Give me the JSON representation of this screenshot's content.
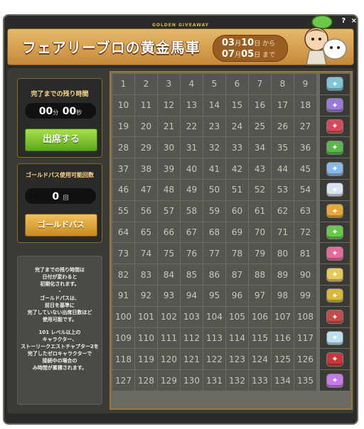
{
  "window": {
    "title": "GOLDEN GIVEAWAY",
    "help_icon": "?",
    "close_icon": "×"
  },
  "banner": {
    "title": "フェアリーブロの黄金馬車",
    "start_month": "03",
    "start_month_suffix": "月",
    "start_day": "10",
    "start_day_suffix": "日 から",
    "end_month": "07",
    "end_month_suffix": "月",
    "end_day": "05",
    "end_day_suffix": "日 まで"
  },
  "remaining": {
    "label": "完了までの残り時間",
    "minutes": "00",
    "minutes_unit": "分",
    "seconds": "00",
    "seconds_unit": "秒",
    "attend_button": "出席する"
  },
  "goldpass": {
    "label": "ゴールドパス使用可能回数",
    "count": "0",
    "count_unit": "回",
    "button": "ゴールドパス"
  },
  "notes": {
    "line1": "完了までの残り時間は",
    "line2": "日付が変わると",
    "line3": "初期化されます。",
    "line4": "-",
    "line5": "ゴールドパスは、",
    "line6": "前日を基準に",
    "line7": "完了していない出席日数ほど",
    "line8": "使用可能です。",
    "line9": "101 レベル以上の",
    "line10": "キャラクター、",
    "line11": "ストーリークエストチャプター2を",
    "line12": "完了したゼロキャラクターで",
    "line13": "接続中の場合の",
    "line14": "み時間が累積されます。"
  },
  "grid": {
    "rows": [
      [
        "1",
        "2",
        "3",
        "4",
        "5",
        "6",
        "7",
        "8",
        "9"
      ],
      [
        "10",
        "11",
        "12",
        "13",
        "14",
        "15",
        "16",
        "17",
        "18"
      ],
      [
        "19",
        "20",
        "21",
        "22",
        "23",
        "24",
        "25",
        "26",
        "27"
      ],
      [
        "28",
        "29",
        "30",
        "31",
        "32",
        "33",
        "34",
        "35",
        "36"
      ],
      [
        "37",
        "38",
        "39",
        "40",
        "41",
        "42",
        "43",
        "44",
        "45"
      ],
      [
        "46",
        "47",
        "48",
        "49",
        "50",
        "51",
        "52",
        "53",
        "54"
      ],
      [
        "55",
        "56",
        "57",
        "58",
        "59",
        "60",
        "61",
        "62",
        "63"
      ],
      [
        "64",
        "65",
        "66",
        "67",
        "68",
        "69",
        "70",
        "71",
        "72"
      ],
      [
        "73",
        "74",
        "75",
        "76",
        "77",
        "78",
        "79",
        "80",
        "81"
      ],
      [
        "82",
        "83",
        "84",
        "85",
        "86",
        "87",
        "88",
        "89",
        "90"
      ],
      [
        "91",
        "92",
        "93",
        "94",
        "95",
        "96",
        "97",
        "98",
        "99"
      ],
      [
        "100",
        "101",
        "102",
        "103",
        "104",
        "105",
        "106",
        "107",
        "108"
      ],
      [
        "109",
        "110",
        "111",
        "112",
        "113",
        "114",
        "115",
        "116",
        "117"
      ],
      [
        "118",
        "119",
        "120",
        "121",
        "122",
        "123",
        "124",
        "125",
        "126"
      ],
      [
        "127",
        "128",
        "129",
        "130",
        "131",
        "132",
        "133",
        "134",
        "135"
      ]
    ]
  },
  "rewards": [
    {
      "icon": "gift-box-icon",
      "color": "#7fc6d8"
    },
    {
      "icon": "coupon-icon",
      "color": "#9a7ad8"
    },
    {
      "icon": "heart-potion-icon",
      "color": "#d84a5a"
    },
    {
      "icon": "green-potion-icon",
      "color": "#5ab84a"
    },
    {
      "icon": "wings-icon",
      "color": "#8ab8e8"
    },
    {
      "icon": "scroll-icon",
      "color": "#d8e4f0"
    },
    {
      "icon": "medal-icon",
      "color": "#e8a83a"
    },
    {
      "icon": "treasure-chest-icon",
      "color": "#6ac84a"
    },
    {
      "icon": "pink-ticket-icon",
      "color": "#e86a9a"
    },
    {
      "icon": "rocket-icon",
      "color": "#e8c85a"
    },
    {
      "icon": "gold-box-icon",
      "color": "#d8b83a"
    },
    {
      "icon": "voucher-icon",
      "color": "#c84a4a"
    },
    {
      "icon": "sparkle-box-icon",
      "color": "#bde0f0"
    },
    {
      "icon": "red-gift-icon",
      "color": "#c8383a"
    },
    {
      "icon": "sparkle-badge-icon",
      "color": "#c87ae8"
    }
  ]
}
